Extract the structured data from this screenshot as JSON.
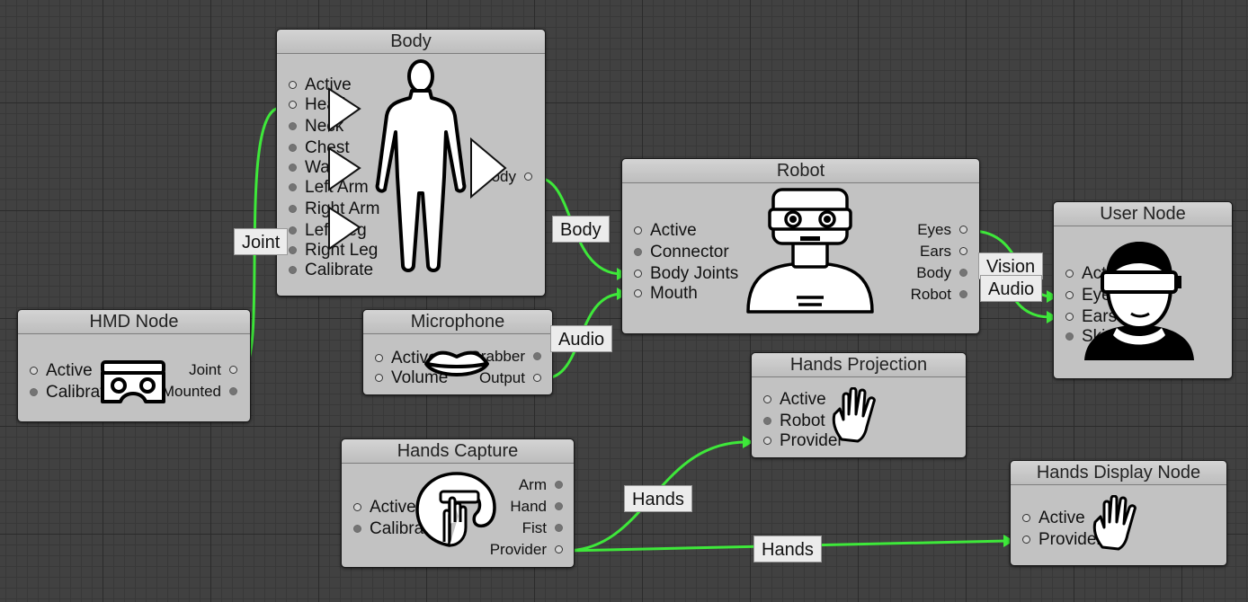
{
  "nodes": {
    "body": {
      "title": "Body",
      "inputs": [
        "Active",
        "Head",
        "Neck",
        "Chest",
        "Waist",
        "Left Arm",
        "Right Arm",
        "Left Leg",
        "Right Leg",
        "Calibrate"
      ],
      "outputs": [
        "Body"
      ]
    },
    "hmd": {
      "title": "HMD Node",
      "inputs": [
        "Active",
        "Calibrate"
      ],
      "outputs": [
        "Joint",
        "Mounted"
      ]
    },
    "microphone": {
      "title": "Microphone",
      "inputs": [
        "Active",
        "Volume"
      ],
      "outputs": [
        "Grabber",
        "Output"
      ]
    },
    "robot": {
      "title": "Robot",
      "inputs": [
        "Active",
        "Connector",
        "Body Joints",
        "Mouth"
      ],
      "outputs": [
        "Eyes",
        "Ears",
        "Body",
        "Robot"
      ]
    },
    "user": {
      "title": "User Node",
      "inputs": [
        "Active",
        "Eyes",
        "Ears",
        "Skin"
      ]
    },
    "hands_projection": {
      "title": "Hands Projection",
      "inputs": [
        "Active",
        "Robot",
        "Provider"
      ]
    },
    "hands_capture": {
      "title": "Hands Capture",
      "inputs": [
        "Active",
        "Calibrate"
      ],
      "outputs": [
        "Arm",
        "Hand",
        "Fist",
        "Provider"
      ]
    },
    "hands_display": {
      "title": "Hands Display Node",
      "inputs": [
        "Active",
        "Provider"
      ]
    }
  },
  "connections": [
    {
      "from": "HMD Node.Joint",
      "to": "Body.Head",
      "label": "Joint"
    },
    {
      "from": "Body.Body",
      "to": "Robot.Body Joints",
      "label": "Body"
    },
    {
      "from": "Microphone.Output",
      "to": "Robot.Mouth",
      "label": "Audio"
    },
    {
      "from": "Robot.Eyes",
      "to": "User Node.Eyes",
      "label": "Vision"
    },
    {
      "from": "Robot.Ears",
      "to": "User Node.Ears",
      "label": "Audio"
    },
    {
      "from": "Hands Capture.Provider",
      "to": "Hands Projection.Provider",
      "label": "Hands"
    },
    {
      "from": "Hands Capture.Provider",
      "to": "Hands Display Node.Provider",
      "label": "Hands"
    }
  ],
  "colors": {
    "canvas": "#414141",
    "node": "#c2c2c2",
    "wire": "#3ee83a",
    "label_bg": "#ececec"
  },
  "icons": [
    "human-body-icon",
    "vr-headset-icon",
    "lips-icon",
    "robot-icon",
    "vr-user-icon",
    "open-hand-icon",
    "hand-grip-icon"
  ]
}
